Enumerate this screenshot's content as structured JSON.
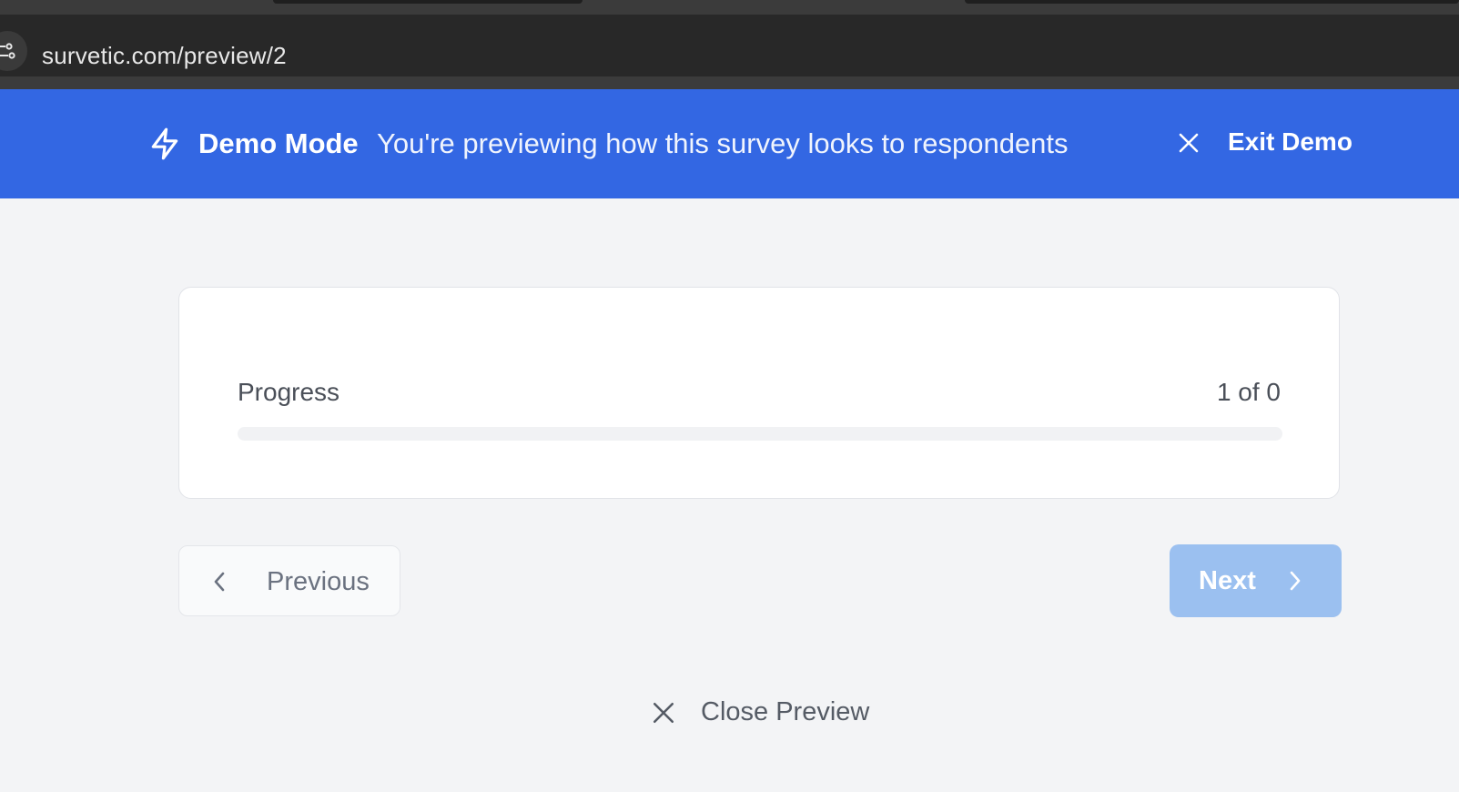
{
  "browser": {
    "url": "survetic.com/preview/2",
    "site_icon": "site-settings-icon"
  },
  "banner": {
    "icon": "lightning-bolt-icon",
    "title": "Demo Mode",
    "description": "You're previewing how this survey looks to respondents",
    "exit_icon": "close-icon",
    "exit_label": "Exit Demo",
    "color": "#3367e3"
  },
  "progress": {
    "label": "Progress",
    "count_text": "1 of 0",
    "fraction": 0
  },
  "navigation": {
    "previous_label": "Previous",
    "previous_icon": "chevron-left-icon",
    "next_label": "Next",
    "next_icon": "chevron-right-icon",
    "next_color": "#9bc0f0"
  },
  "footer": {
    "close_preview_label": "Close Preview",
    "close_icon": "close-icon"
  }
}
